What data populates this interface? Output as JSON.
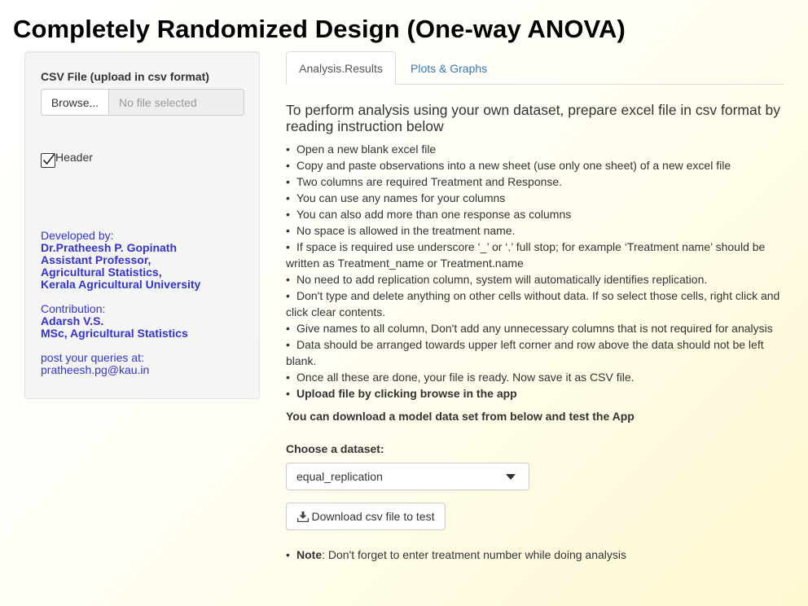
{
  "page": {
    "title": "Completely Randomized Design (One-way ANOVA)"
  },
  "sidebar": {
    "file_label": "CSV File (upload in csv format)",
    "browse_label": "Browse...",
    "file_placeholder": "No file selected",
    "header_label": "Header",
    "header_checked": true,
    "credits": {
      "developed_by_label": "Developed by:",
      "developer_name": "Dr.Pratheesh P. Gopinath",
      "developer_title": "Assistant Professor,",
      "developer_dept": "Agricultural Statistics,",
      "developer_org": "Kerala Agricultural University",
      "contribution_label": "Contribution:",
      "contributor_name": "Adarsh V.S.",
      "contributor_title": "MSc, Agricultural Statistics",
      "queries_label": "post your queries at:",
      "email": "pratheesh.pg@kau.in"
    }
  },
  "main": {
    "tabs": [
      {
        "label": "Analysis.Results",
        "active": true
      },
      {
        "label": "Plots & Graphs",
        "active": false
      }
    ],
    "intro": "To perform analysis using your own dataset, prepare excel file in csv format by reading instruction below",
    "instructions": [
      {
        "text": "Open a new blank excel file",
        "bold": false
      },
      {
        "text": "Copy and paste observations into a new sheet (use only one sheet) of a new excel file",
        "bold": false
      },
      {
        "text": "Two columns are required Treatment and Response.",
        "bold": false
      },
      {
        "text": "You can use any names for your columns",
        "bold": false
      },
      {
        "text": "You can also add more than one response as columns",
        "bold": false
      },
      {
        "text": "No space is allowed in the treatment name.",
        "bold": false
      },
      {
        "text": "If space is required use underscore ‘_’ or ‘.’ full stop; for example ‘Treatment name’ should be written as Treatment_name or Treatment.name",
        "bold": false
      },
      {
        "text": "No need to add replication column, system will automatically identifies replication.",
        "bold": false
      },
      {
        "text": "Don't type and delete anything on other cells without data. If so select those cells, right click and click clear contents.",
        "bold": false
      },
      {
        "text": "Give names to all column, Don't add any unnecessary columns that is not required for analysis",
        "bold": false
      },
      {
        "text": "Data should be arranged towards upper left corner and row above the data should not be left blank.",
        "bold": false
      },
      {
        "text": "Once all these are done, your file is ready. Now save it as CSV file.",
        "bold": false
      },
      {
        "text": "Upload file by clicking browse in the app",
        "bold": true
      }
    ],
    "download_note": "You can download a model data set from below and test the App",
    "dataset_label": "Choose a dataset:",
    "dataset_selected": "equal_replication",
    "download_button": "Download csv file to test",
    "note_label": "Note",
    "note_text": ": Don't forget to enter treatment number while doing analysis"
  },
  "colors": {
    "link": "#337ab7",
    "credits": "#3333cc",
    "text": "#333333"
  },
  "icons": {
    "checkbox_check": "check-icon",
    "dropdown": "caret-down-icon",
    "download": "download-icon"
  }
}
